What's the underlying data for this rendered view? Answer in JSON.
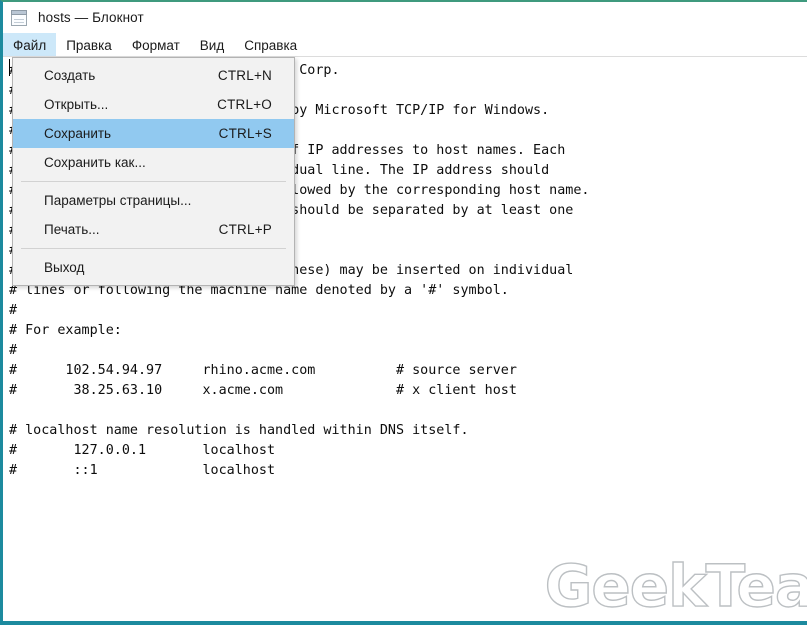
{
  "window": {
    "title": "hosts — Блокнот",
    "icon": "notepad-icon",
    "border_color": "#1c8a9e",
    "top_border_color": "#3f9a7e"
  },
  "menubar": {
    "items": [
      {
        "label": "Файл",
        "active": true
      },
      {
        "label": "Правка",
        "active": false
      },
      {
        "label": "Формат",
        "active": false
      },
      {
        "label": "Вид",
        "active": false
      },
      {
        "label": "Справка",
        "active": false
      }
    ],
    "active_highlight_color": "#cde8f9"
  },
  "file_menu": {
    "open": true,
    "highlight_color": "#91c9f0",
    "items": [
      {
        "label": "Создать",
        "accel": "CTRL+N",
        "selected": false,
        "separator_after": false
      },
      {
        "label": "Открыть...",
        "accel": "CTRL+O",
        "selected": false,
        "separator_after": false
      },
      {
        "label": "Сохранить",
        "accel": "CTRL+S",
        "selected": true,
        "separator_after": false
      },
      {
        "label": "Сохранить как...",
        "accel": "",
        "selected": false,
        "separator_after": true
      },
      {
        "label": "Параметры страницы...",
        "accel": "",
        "selected": false,
        "separator_after": false
      },
      {
        "label": "Печать...",
        "accel": "CTRL+P",
        "selected": false,
        "separator_after": true
      },
      {
        "label": "Выход",
        "accel": "",
        "selected": false,
        "separator_after": false
      }
    ]
  },
  "editor": {
    "content": "# Copyright (c) 1993-2009 Microsoft Corp.\n#\n# This is a sample HOSTS file used by Microsoft TCP/IP for Windows.\n#\n# This file contains the mappings of IP addresses to host names. Each\n# entry should be kept on an individual line. The IP address should\n# be placed in the first column followed by the corresponding host name.\n# The IP address and the host name should be separated by at least one\n# space.\n#\n# Additionally, comments (such as these) may be inserted on individual\n# lines or following the machine name denoted by a '#' symbol.\n#\n# For example:\n#\n#      102.54.94.97     rhino.acme.com          # source server\n#       38.25.63.10     x.acme.com              # x client host\n\n# localhost name resolution is handled within DNS itself.\n#\t127.0.0.1       localhost\n#\t::1             localhost"
  },
  "watermark": {
    "text": "GeekTea"
  }
}
